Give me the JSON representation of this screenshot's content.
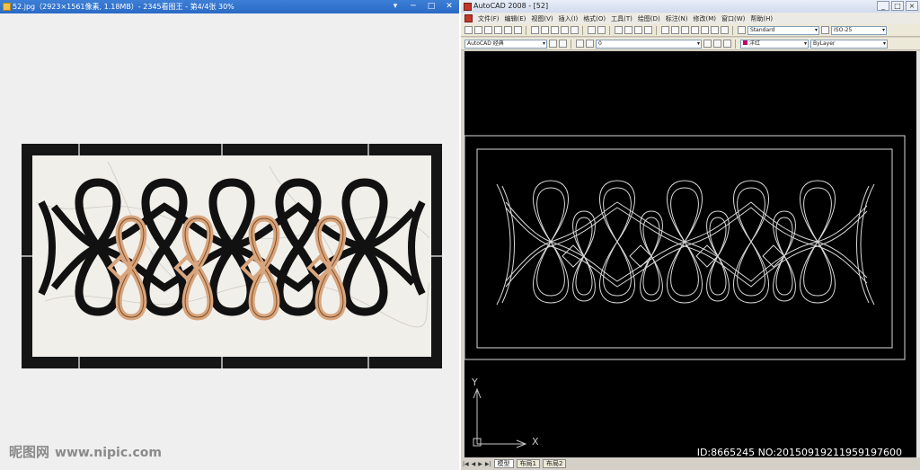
{
  "viewer": {
    "title": "52.jpg（2923×1561像素, 1.18MB）- 2345看图王 - 第4/4张 30%",
    "controls": [
      "▾",
      "─",
      "□",
      "✕"
    ],
    "watermark_brand": "昵图网",
    "watermark_url": "www.nipic.com"
  },
  "cad": {
    "title": "AutoCAD 2008 - [52]",
    "window_controls": [
      "_",
      "□",
      "×"
    ],
    "menu": [
      "文件(F)",
      "编辑(E)",
      "视图(V)",
      "插入(I)",
      "格式(O)",
      "工具(T)",
      "绘图(D)",
      "标注(N)",
      "修改(M)",
      "窗口(W)",
      "帮助(H)"
    ],
    "workspace": "AutoCAD 经典",
    "text_style": "Standard",
    "dim_style": "ISO-25",
    "layer": "0",
    "color_value": "洋红",
    "linetype": "ByLayer",
    "tabs": [
      "模型",
      "布局1",
      "布局2"
    ],
    "ucs_y": "Y",
    "ucs_x": "X",
    "stamp": "ID:8665245 NO:20150919211959197600"
  },
  "colors": {
    "marble": "#f1efea",
    "border_black": "#151515",
    "loop_black": "#111111",
    "loop_tan": "#d8a57d",
    "cad_bg": "#000000",
    "cad_line": "#d8d8d8"
  }
}
